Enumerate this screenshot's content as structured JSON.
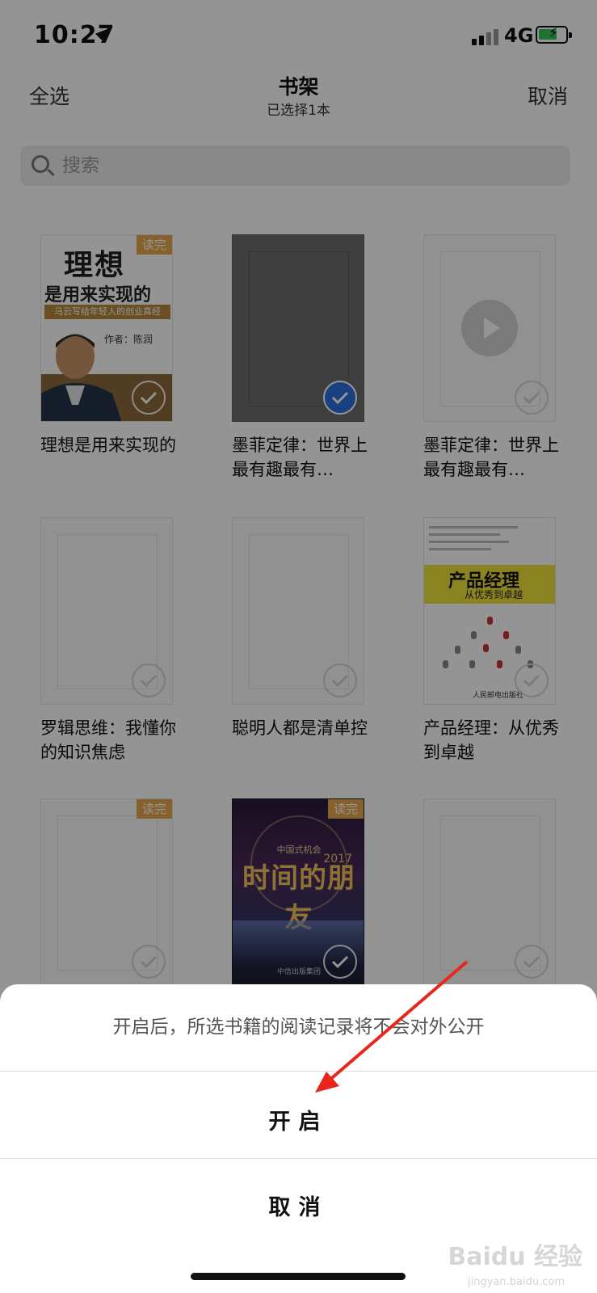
{
  "status_bar": {
    "time": "10:27",
    "network": "4G"
  },
  "nav": {
    "left": "全选",
    "title": "书架",
    "subtitle": "已选择1本",
    "right": "取消"
  },
  "search": {
    "placeholder": "搜索"
  },
  "books": [
    {
      "title": "理想是用来实现的",
      "badge": "读完",
      "selected": false,
      "cover": {
        "title_line1": "理想",
        "title_line2": "是用来实现的",
        "band": "马云写给年轻人的创业真经",
        "author": "作者：陈润"
      }
    },
    {
      "title": "墨菲定律：世界上最有趣最有…",
      "selected": true
    },
    {
      "title": "墨菲定律：世界上最有趣最有…",
      "selected": false
    },
    {
      "title": "罗辑思维：我懂你的知识焦虑",
      "selected": false
    },
    {
      "title": "聪明人都是清单控",
      "selected": false
    },
    {
      "title": "产品经理：从优秀到卓越",
      "selected": false,
      "cover": {
        "title": "产品经理",
        "subtitle": "从优秀到卓越",
        "publisher": "人民邮电出版社"
      }
    },
    {
      "title": "",
      "badge": "读完",
      "selected": false
    },
    {
      "title": "",
      "badge": "读完",
      "selected": false,
      "cover": {
        "top": "中国式机会",
        "title": "时间的朋友",
        "year": "2017",
        "publisher": "中信出版集团"
      }
    },
    {
      "title": "",
      "selected": false
    }
  ],
  "action_sheet": {
    "message": "开启后，所选书籍的阅读记录将不会对外公开",
    "confirm": "开启",
    "cancel": "取消"
  },
  "watermark": {
    "brand": "Baidu 经验",
    "url": "jingyan.baidu.com"
  },
  "colors": {
    "selected_check": "#2f6fe0",
    "badge": "#e8a84a",
    "annotation_arrow": "#e8261e"
  }
}
